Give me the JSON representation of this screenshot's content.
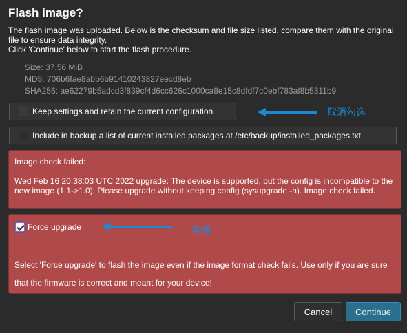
{
  "dialog": {
    "title": "Flash image?",
    "intro_line1": "The flash image was uploaded. Below is the checksum and file size listed, compare them with the original file to ensure data integrity.",
    "intro_line2": "Click 'Continue' below to start the flash procedure."
  },
  "file_info": {
    "size": "Size: 37.56 MiB",
    "md5": "MD5: 706b6fae8abb6b91410243827eecd8eb",
    "sha256": "SHA256: ae62279b5adcd3f839cf4d6cc626c1000ca8e15c8dfdf7c0ebf783af8b5311b9"
  },
  "options": {
    "keep_settings": {
      "label": "Keep settings and retain the current configuration",
      "checked": false
    },
    "include_packages": {
      "label": "Include in backup a list of current installed packages at /etc/backup/installed_packages.txt",
      "checked": false
    }
  },
  "alert_check": {
    "heading": "Image check failed:",
    "detail": "Wed Feb 16 20:38:03 UTC 2022 upgrade: The device is supported, but the config is incompatible to the new image (1.1->1.0). Please upgrade without keeping config (sysupgrade -n). Image check failed."
  },
  "alert_force": {
    "force_label": "Force upgrade",
    "force_checked": true,
    "message": "Select 'Force upgrade' to flash the image even if the image format check fails. Use only if you are sure that the firmware is correct and meant for your device!"
  },
  "annotations": {
    "uncheck_label": "取消勾选",
    "check_label": "勾选",
    "arrow_color": "#1a8ad4"
  },
  "buttons": {
    "cancel": "Cancel",
    "continue": "Continue"
  },
  "colors": {
    "background": "#2b2b2b",
    "alert": "#b04a4a",
    "continue_button": "#2a6f8d"
  }
}
